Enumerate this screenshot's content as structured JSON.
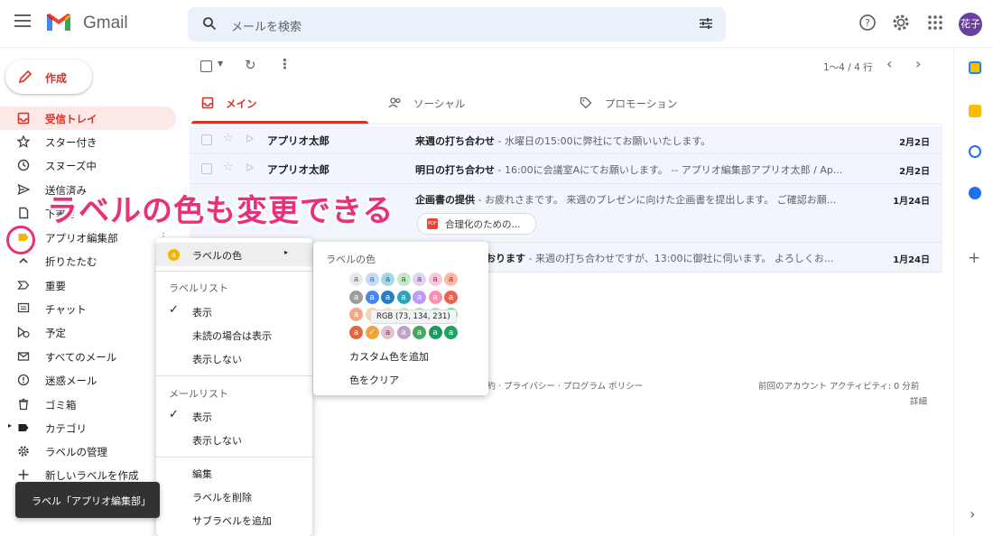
{
  "header": {
    "app_name": "Gmail",
    "search_placeholder": "メールを検索",
    "avatar_text": "花子"
  },
  "compose_label": "作成",
  "sidebar": {
    "items": [
      {
        "label": "受信トレイ",
        "icon": "inbox-icon",
        "active": true
      },
      {
        "label": "スター付き",
        "icon": "star-icon"
      },
      {
        "label": "スヌーズ中",
        "icon": "clock-icon"
      },
      {
        "label": "送信済み",
        "icon": "send-icon"
      },
      {
        "label": "下書き",
        "icon": "draft-icon"
      },
      {
        "label": "アプリオ編集部",
        "icon": "label-icon"
      },
      {
        "label": "折りたたむ",
        "icon": "chevron-up-icon"
      },
      {
        "label": "重要",
        "icon": "important-icon"
      },
      {
        "label": "チャット",
        "icon": "chat-icon"
      },
      {
        "label": "予定",
        "icon": "scheduled-icon"
      },
      {
        "label": "すべてのメール",
        "icon": "all-mail-icon"
      },
      {
        "label": "迷惑メール",
        "icon": "spam-icon"
      },
      {
        "label": "ゴミ箱",
        "icon": "trash-icon"
      },
      {
        "label": "カテゴリ",
        "icon": "category-icon"
      },
      {
        "label": "ラベルの管理",
        "icon": "gear-icon"
      },
      {
        "label": "新しいラベルを作成",
        "icon": "plus-icon"
      }
    ]
  },
  "toolbar": {
    "pager": "1～4 / 4 行"
  },
  "tabs": [
    {
      "label": "メイン",
      "icon": "inbox-icon"
    },
    {
      "label": "ソーシャル",
      "icon": "people-icon"
    },
    {
      "label": "プロモーション",
      "icon": "tag-icon"
    }
  ],
  "emails": [
    {
      "sender": "アプリオ太郎",
      "subject": "来週の打ち合わせ",
      "snippet": " - 水曜日の15:00に弊社にてお願いいたします。",
      "date": "2月2日"
    },
    {
      "sender": "アプリオ太郎",
      "subject": "明日の打ち合わせ",
      "snippet": " - 16:00に会議室Aにてお願いします。 -- アプリオ編集部アプリオ太郎 / Ap...",
      "date": "2月2日"
    },
    {
      "sender": "",
      "subject": "企画書の提供",
      "snippet": " - お疲れさまです。 来週のプレゼンに向けた企画書を提出します。 ご確認お願...",
      "date": "1月24日",
      "attachment": "合理化のための..."
    },
    {
      "sender": "",
      "subject": "おります",
      "snippet": " - 来週の打ち合わせですが、13:00に御社に伺います。 よろしくお...",
      "date": "1月24日"
    }
  ],
  "footer": {
    "links": "規約 · プライバシー · プログラム ポリシー",
    "activity": "前回のアカウント アクティビティ: 0 分前",
    "details": "詳細"
  },
  "overlay_title": "ラベルの色も変更できる",
  "context_menu": {
    "label_color": "ラベルの色",
    "label_list_header": "ラベルリスト",
    "label_list_options": [
      "表示",
      "未読の場合は表示",
      "表示しない"
    ],
    "mail_list_header": "メールリスト",
    "mail_list_options": [
      "表示",
      "表示しない"
    ],
    "actions": [
      "編集",
      "ラベルを削除",
      "サブラベルを追加"
    ]
  },
  "color_panel": {
    "header": "ラベルの色",
    "swatch_letter": "a",
    "tooltip": "RGB (73, 134, 231)",
    "add_custom": "カスタム色を追加",
    "clear": "色をクリア",
    "rows": [
      [
        {
          "bg": "#e8eaed",
          "fg": "#5f6368"
        },
        {
          "bg": "#c6dafc",
          "fg": "#1a73e8"
        },
        {
          "bg": "#a4d7e7",
          "fg": "#0b6a86"
        },
        {
          "bg": "#c8e6c9",
          "fg": "#137333"
        },
        {
          "bg": "#e1d3f3",
          "fg": "#8e24aa"
        },
        {
          "bg": "#f8c9d8",
          "fg": "#c2185b"
        },
        {
          "bg": "#f9b9a5",
          "fg": "#c5221f"
        }
      ],
      [
        {
          "bg": "#9e9e9e",
          "fg": "#ffffff"
        },
        {
          "bg": "#4986e7",
          "fg": "#ffffff"
        },
        {
          "bg": "#2a7ebf",
          "fg": "#ffffff"
        },
        {
          "bg": "#2da2bb",
          "fg": "#ffffff"
        },
        {
          "bg": "#b99aff",
          "fg": "#ffffff"
        },
        {
          "bg": "#f691b2",
          "fg": "#ffffff"
        },
        {
          "bg": "#e66550",
          "fg": "#ffffff"
        }
      ],
      [
        {
          "bg": "#f4a688",
          "fg": "#ffffff"
        },
        {
          "bg": "#fbd3a3",
          "fg": "#a65a00"
        },
        {
          "bg": "#fce8b2",
          "fg": "#8a6d00"
        },
        {
          "bg": "#d3e3b5",
          "fg": "#4a6a1a"
        },
        {
          "bg": "#b3e1c6",
          "fg": "#137333"
        },
        {
          "bg": "#a6dbb9",
          "fg": "#0d652d"
        },
        {
          "bg": "#89d3b2",
          "fg": "#0d652d"
        }
      ],
      [
        {
          "bg": "#e8643c",
          "fg": "#ffffff"
        },
        {
          "bg": "#f4a23b",
          "fg": "#ffffff"
        },
        {
          "bg": "#e0c3cf",
          "fg": "#8b2e5a"
        },
        {
          "bg": "#c2a4c4",
          "fg": "#ffffff"
        },
        {
          "bg": "#43a862",
          "fg": "#ffffff"
        },
        {
          "bg": "#1c9a5b",
          "fg": "#ffffff"
        },
        {
          "bg": "#16a765",
          "fg": "#ffffff"
        }
      ]
    ],
    "selected_swatch": {
      "row": 3,
      "col": 1
    }
  },
  "snackbar": "ラベル「アプリオ編集部」",
  "colors": {
    "accent": "#d93025",
    "highlight": "#e8317a",
    "label_color": "#f4b400"
  }
}
